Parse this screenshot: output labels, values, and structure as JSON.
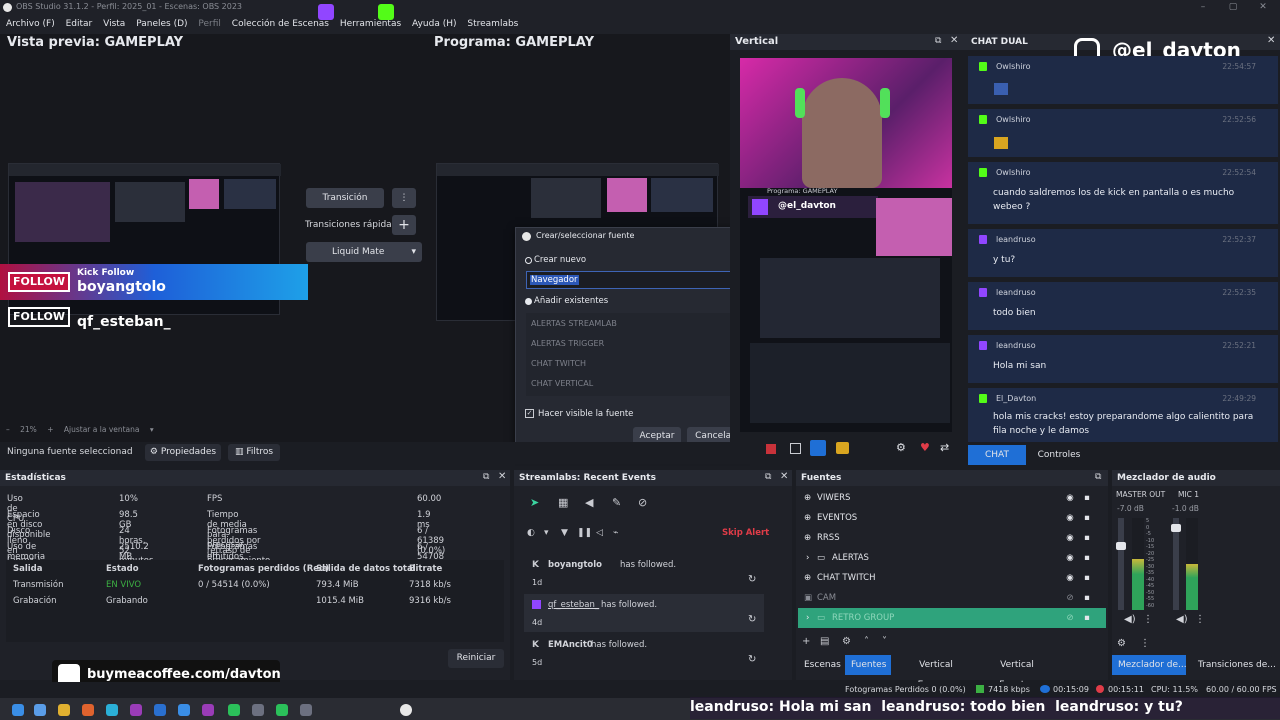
{
  "window": {
    "title": "OBS Studio 31.1.2 - Perfil: 2025_01 - Escenas: OBS 2023"
  },
  "menu": [
    "Archivo (F)",
    "Editar",
    "Vista",
    "Paneles (D)",
    "Perfil",
    "Colección de Escenas",
    "Herramientas",
    "Ayuda (H)",
    "Streamlabs"
  ],
  "preview": {
    "title": "Vista previa: GAMEPLAY",
    "zoom": "21%",
    "fit_label": "Ajustar a la ventana"
  },
  "program": {
    "title": "Programa: GAMEPLAY"
  },
  "transition": {
    "button": "Transición",
    "quick_label": "Transiciones rápidas",
    "selected": "Liquid Mate"
  },
  "follow_overlay": {
    "badge": "FOLLOW",
    "caption": "Kick Follow",
    "user1": "boyangtolo",
    "user2": "qf_esteban_"
  },
  "source_bar": {
    "status": "Ninguna fuente seleccionad",
    "properties": "Propiedades",
    "filters": "Filtros"
  },
  "dialog": {
    "title": "Crear/seleccionar fuente",
    "create_new": "Crear nuevo",
    "name_value": "Navegador",
    "add_existing": "Añadir existentes",
    "existing": [
      "ALERTAS STREAMLAB",
      "ALERTAS TRIGGER",
      "CHAT TWITCH",
      "CHAT VERTICAL"
    ],
    "visible_label": "Hacer visible la fuente",
    "accept": "Aceptar",
    "cancel": "Cancelar"
  },
  "vertical": {
    "title": "Vertical",
    "program_label": "Programa: GAMEPLAY",
    "handle": "@el_davton"
  },
  "chat": {
    "title": "CHAT DUAL",
    "instagram_handle": "@el_davton",
    "messages": [
      {
        "user": "Owlshiro",
        "time": "22:54:57",
        "text": "",
        "platform": "kick"
      },
      {
        "user": "Owlshiro",
        "time": "22:52:56",
        "text": "",
        "platform": "kick"
      },
      {
        "user": "Owlshiro",
        "time": "22:52:54",
        "text": "cuando saldremos los de kick en pantalla o es mucho webeo ?",
        "platform": "kick"
      },
      {
        "user": "leandruso",
        "time": "22:52:37",
        "text": "y tu?",
        "platform": "twitch"
      },
      {
        "user": "leandruso",
        "time": "22:52:35",
        "text": "todo bien",
        "platform": "twitch"
      },
      {
        "user": "leandruso",
        "time": "22:52:21",
        "text": "Hola mi san",
        "platform": "twitch"
      },
      {
        "user": "El_Davton",
        "time": "22:49:29",
        "text": "hola mis cracks! estoy preparandome algo calientito para fila noche y le damos",
        "platform": "kick"
      }
    ],
    "tabs": [
      "CHAT DUAL",
      "Controles"
    ]
  },
  "stats": {
    "title": "Estadísticas",
    "rows": [
      [
        "Uso de CPU",
        "10%",
        "FPS",
        "60.00"
      ],
      [
        "Espacio en disco disponible",
        "98.5 GB",
        "Tiempo de media para procesar un fotograma",
        "1.9 ms"
      ],
      [
        "Disco lleno en (aprox.)",
        "24 horas, 52 minutos",
        "Fotogramas perdidos por retraso de procesamiento",
        "6 / 61389 (0.0%)"
      ],
      [
        "Uso de memoria",
        "2510.2 MB",
        "Fotogramas omitidos por retraso en la codificación",
        "6 / 54708 (0.0%)"
      ]
    ],
    "table_headers": [
      "Salida",
      "Estado",
      "Fotogramas perdidos (Red)",
      "Salida de datos total",
      "Bitrate"
    ],
    "table_rows": [
      [
        "Transmisión",
        "EN VIVO",
        "0 / 54514 (0.0%)",
        "793.4 MiB",
        "7318 kb/s"
      ],
      [
        "Grabación",
        "Grabando",
        "",
        "1015.4 MiB",
        "9316 kb/s"
      ]
    ],
    "reset": "Reiniciar"
  },
  "events": {
    "title": "Streamlabs: Recent Events",
    "skip": "Skip Alert",
    "items": [
      {
        "user": "boyangtolo",
        "action": "has followed.",
        "age": "1d"
      },
      {
        "user": "qf_esteban_",
        "action": "has followed.",
        "age": "4d"
      },
      {
        "user": "EMAncit0",
        "action": "has followed.",
        "age": "5d"
      }
    ]
  },
  "sources": {
    "title": "Fuentes",
    "items": [
      "VIWERS",
      "EVENTOS",
      "RRSS",
      "ALERTAS",
      "CHAT TWITCH",
      "CAM",
      "RETRO GROUP"
    ],
    "tabs": [
      "Escenas",
      "Fuentes",
      "Vertical Escenas",
      "Vertical Fuentes"
    ]
  },
  "mixer": {
    "title": "Mezclador de audio",
    "channels": [
      {
        "name": "MASTER OUT",
        "db": "-7.0 dB",
        "level": 0.55
      },
      {
        "name": "MIC 1",
        "db": "-1.0 dB",
        "level": 0.5
      }
    ],
    "scale": [
      "5",
      "0",
      "-5",
      "-10",
      "-15",
      "-20",
      "-25",
      "-30",
      "-35",
      "-40",
      "-45",
      "-50",
      "-55",
      "-60"
    ],
    "tabs": [
      "Mezclador de...",
      "Transiciones de..."
    ]
  },
  "statusbar": {
    "dropped": "Fotogramas Perdidos 0 (0.0%)",
    "kbps": "7418 kbps",
    "stream_time": "00:15:09",
    "rec_time": "00:15:11",
    "cpu": "CPU: 11.5%",
    "fps": "60.00 / 60.00 FPS"
  },
  "coffee": "buymeacoffee.com/davton",
  "ticker": "leandruso: Hola mi san  leandruso: todo bien  leandruso: y tu?",
  "colors": {
    "accent": "#1f6fd6",
    "kick": "#53fc18",
    "twitch": "#9146ff",
    "live": "#3cb043",
    "chat_bg": "#1e2a46"
  }
}
